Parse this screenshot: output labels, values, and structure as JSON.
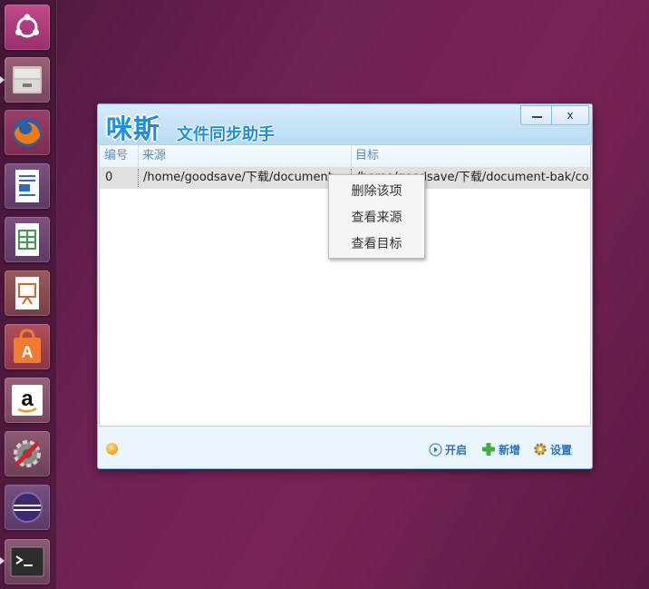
{
  "launcher": {
    "items": [
      {
        "name": "ubuntu-dash-icon"
      },
      {
        "name": "files-icon"
      },
      {
        "name": "firefox-icon"
      },
      {
        "name": "writer-icon"
      },
      {
        "name": "calc-icon"
      },
      {
        "name": "impress-icon"
      },
      {
        "name": "software-center-icon"
      },
      {
        "name": "amazon-icon"
      },
      {
        "name": "system-settings-icon"
      },
      {
        "name": "eclipse-icon"
      },
      {
        "name": "terminal-icon"
      }
    ]
  },
  "window": {
    "logo_main": "咪斯",
    "logo_sub": "文件同步助手",
    "minimize_symbol": "_",
    "close_symbol": "x"
  },
  "table": {
    "columns": [
      "编号",
      "来源",
      "目标"
    ],
    "rows": [
      {
        "id": "0",
        "source": "/home/goodsave/下载/document",
        "target": "/home/goodsave/下载/document-bak/config"
      }
    ]
  },
  "context_menu": {
    "items": [
      "删除该项",
      "查看来源",
      "查看目标"
    ]
  },
  "footer": {
    "start_label": "开启",
    "add_label": "新增",
    "settings_label": "设置"
  },
  "colors": {
    "accent": "#1e8fe0",
    "link": "#2a72c0",
    "header_text": "#5b8fc0"
  }
}
